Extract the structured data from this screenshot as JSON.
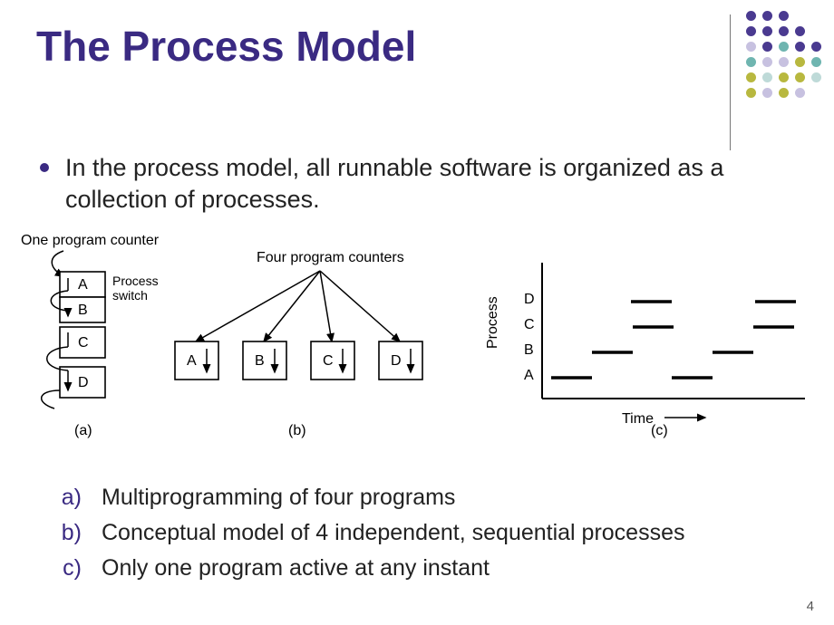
{
  "title": "The Process Model",
  "main_bullet": "In the process model, all runnable software is organized as a collection of processes.",
  "figure": {
    "label_one_pc": "One program counter",
    "label_process_switch": "Process\nswitch",
    "label_four_pcs": "Four program counters",
    "ylab": "Process",
    "xlab": "Time",
    "proc_labels": [
      "A",
      "B",
      "C",
      "D"
    ],
    "sub_a": "(a)",
    "sub_b": "(b)",
    "sub_c": "(c)"
  },
  "sublist": [
    {
      "label": "a)",
      "text": "Multiprogramming of four programs"
    },
    {
      "label": "b)",
      "text": "Conceptual model of 4 independent, sequential processes"
    },
    {
      "label": "c)",
      "text": "Only one program active at any instant"
    }
  ],
  "page_number": "4"
}
